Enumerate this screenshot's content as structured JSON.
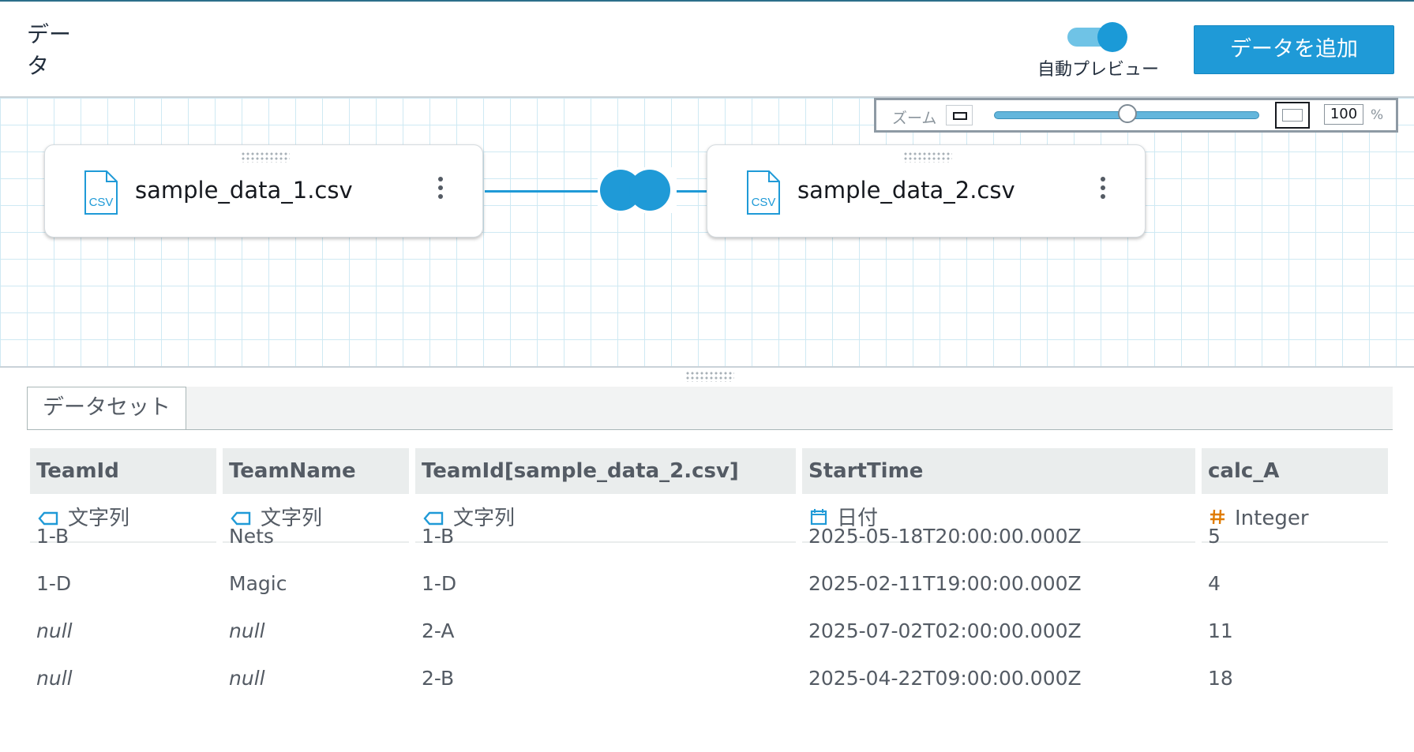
{
  "header": {
    "title": "データ",
    "auto_preview_label": "自動プレビュー",
    "auto_preview_on": true,
    "add_data_label": "データを追加"
  },
  "zoom": {
    "label": "ズーム",
    "value": "100",
    "unit": "%",
    "slider_fraction": 0.47
  },
  "nodes": [
    {
      "name": "sample_data_1.csv",
      "icon": "csv-file-icon",
      "icon_text": "CSV"
    },
    {
      "name": "sample_data_2.csv",
      "icon": "csv-file-icon",
      "icon_text": "CSV"
    }
  ],
  "join": {
    "icon": "join-icon"
  },
  "colors": {
    "accent": "#1f9ad7",
    "grid": "#cfe9f3",
    "header_bg": "#eaeded",
    "date_icon": "#1f9ad7",
    "number_icon": "#e07b00"
  },
  "tabs": [
    {
      "label": "データセット"
    }
  ],
  "table": {
    "columns": [
      {
        "name": "TeamId",
        "type": "文字列",
        "type_icon": "tag-icon"
      },
      {
        "name": "TeamName",
        "type": "文字列",
        "type_icon": "tag-icon"
      },
      {
        "name": "TeamId[sample_data_2.csv]",
        "type": "文字列",
        "type_icon": "tag-icon"
      },
      {
        "name": "StartTime",
        "type": "日付",
        "type_icon": "calendar-icon"
      },
      {
        "name": "calc_A",
        "type": "Integer",
        "type_icon": "hash-icon"
      }
    ],
    "rows": [
      [
        "1-B",
        "Nets",
        "1-B",
        "2025-05-18T20:00:00.000Z",
        "5"
      ],
      [
        "1-D",
        "Magic",
        "1-D",
        "2025-02-11T19:00:00.000Z",
        "4"
      ],
      [
        "null",
        "null",
        "2-A",
        "2025-07-02T02:00:00.000Z",
        "11"
      ],
      [
        "null",
        "null",
        "2-B",
        "2025-04-22T09:00:00.000Z",
        "18"
      ]
    ]
  }
}
